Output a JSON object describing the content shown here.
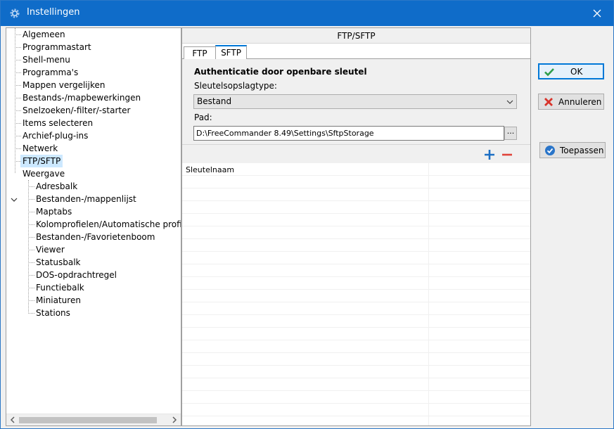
{
  "window": {
    "title": "Instellingen",
    "close_glyph": "✕"
  },
  "tree": {
    "items": [
      {
        "label": "Algemeen",
        "level": 0
      },
      {
        "label": "Programmastart",
        "level": 0
      },
      {
        "label": "Shell-menu",
        "level": 0
      },
      {
        "label": "Programma's",
        "level": 0
      },
      {
        "label": "Mappen vergelijken",
        "level": 0
      },
      {
        "label": "Bestands-/mapbewerkingen",
        "level": 0
      },
      {
        "label": "Snelzoeken/-filter/-starter",
        "level": 0
      },
      {
        "label": "Items selecteren",
        "level": 0
      },
      {
        "label": "Archief-plug-ins",
        "level": 0
      },
      {
        "label": "Netwerk",
        "level": 0
      },
      {
        "label": "FTP/SFTP",
        "level": 0,
        "selected": true
      },
      {
        "label": "Weergave",
        "level": 0,
        "expanded": true
      },
      {
        "label": "Adresbalk",
        "level": 1
      },
      {
        "label": "Bestanden-/mappenlijst",
        "level": 1
      },
      {
        "label": "Maptabs",
        "level": 1
      },
      {
        "label": "Kolomprofielen/Automatische profielen",
        "level": 1
      },
      {
        "label": "Bestanden-/Favorietenboom",
        "level": 1
      },
      {
        "label": "Viewer",
        "level": 1
      },
      {
        "label": "Statusbalk",
        "level": 1
      },
      {
        "label": "DOS-opdrachtregel",
        "level": 1
      },
      {
        "label": "Functiebalk",
        "level": 1
      },
      {
        "label": "Miniaturen",
        "level": 1
      },
      {
        "label": "Stations",
        "level": 1
      }
    ]
  },
  "panel": {
    "header": "FTP/SFTP",
    "tabs": [
      {
        "label": "FTP",
        "active": false
      },
      {
        "label": "SFTP",
        "active": true
      }
    ],
    "section_title": "Authenticatie door openbare sleutel",
    "storage_type_label": "Sleutelsopslagtype:",
    "storage_type_value": "Bestand",
    "path_label": "Pad:",
    "path_value": "D:\\FreeCommander 8.49\\Settings\\SftpStorage",
    "browse_label": "...",
    "list_column": "Sleutelnaam"
  },
  "buttons": {
    "ok": "OK",
    "cancel": "Annuleren",
    "apply": "Toepassen"
  },
  "colors": {
    "titlebar": "#0f6cc9",
    "selection": "#cce8ff",
    "accent": "#0078d7",
    "add": "#1c6fc4",
    "remove": "#e0443a"
  }
}
